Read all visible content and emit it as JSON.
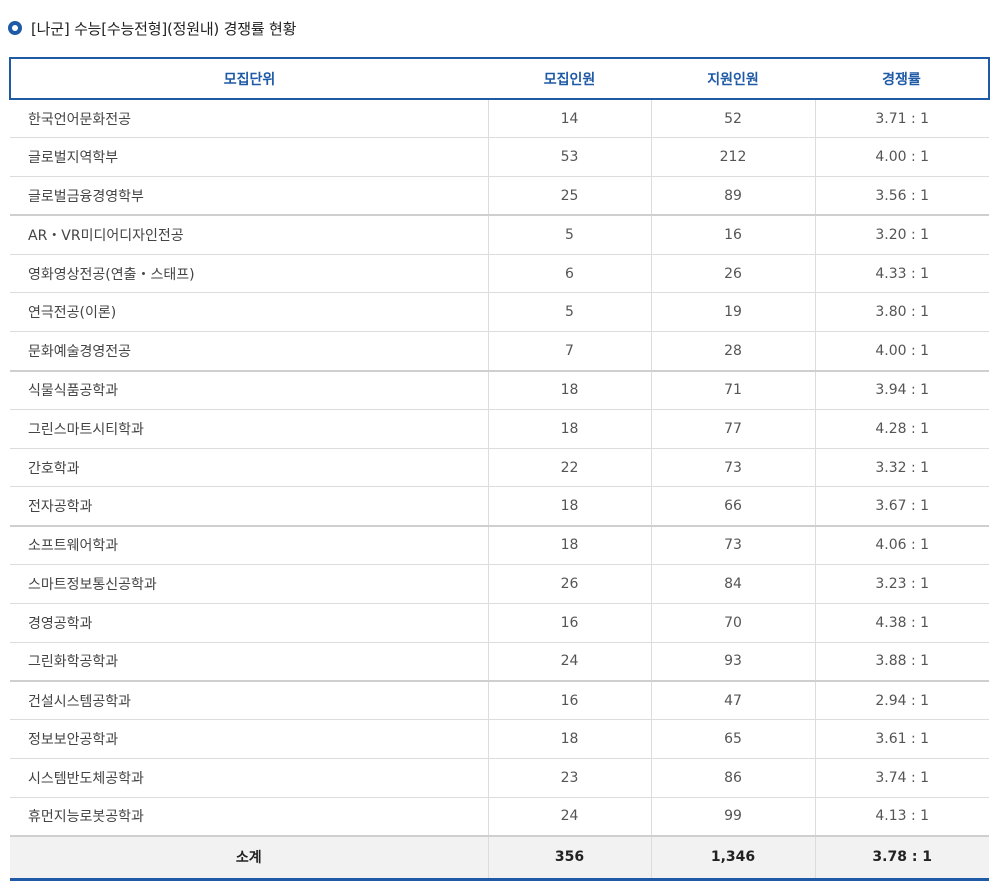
{
  "title": "[나군] 수능[수능전형](정원내) 경쟁률 현황",
  "colors": {
    "accent": "#1f5aa6",
    "footer_bg": "#f2f2f2",
    "grid_line": "#dcdcdc"
  },
  "icons": {
    "bullet": "radio-bullet-icon"
  },
  "table": {
    "headers": {
      "unit": "모집단위",
      "quota": "모집인원",
      "applicants": "지원인원",
      "ratio": "경쟁률"
    },
    "rows": [
      {
        "unit": "한국언어문화전공",
        "quota": "14",
        "applicants": "52",
        "ratio": "3.71 : 1"
      },
      {
        "unit": "글로벌지역학부",
        "quota": "53",
        "applicants": "212",
        "ratio": "4.00 : 1"
      },
      {
        "unit": "글로벌금융경영학부",
        "quota": "25",
        "applicants": "89",
        "ratio": "3.56 : 1"
      },
      {
        "unit": "AR・VR미디어디자인전공",
        "quota": "5",
        "applicants": "16",
        "ratio": "3.20 : 1"
      },
      {
        "unit": "영화영상전공(연출・스태프)",
        "quota": "6",
        "applicants": "26",
        "ratio": "4.33 : 1"
      },
      {
        "unit": "연극전공(이론)",
        "quota": "5",
        "applicants": "19",
        "ratio": "3.80 : 1"
      },
      {
        "unit": "문화예술경영전공",
        "quota": "7",
        "applicants": "28",
        "ratio": "4.00 : 1"
      },
      {
        "unit": "식물식품공학과",
        "quota": "18",
        "applicants": "71",
        "ratio": "3.94 : 1"
      },
      {
        "unit": "그린스마트시티학과",
        "quota": "18",
        "applicants": "77",
        "ratio": "4.28 : 1"
      },
      {
        "unit": "간호학과",
        "quota": "22",
        "applicants": "73",
        "ratio": "3.32 : 1"
      },
      {
        "unit": "전자공학과",
        "quota": "18",
        "applicants": "66",
        "ratio": "3.67 : 1"
      },
      {
        "unit": "소프트웨어학과",
        "quota": "18",
        "applicants": "73",
        "ratio": "4.06 : 1"
      },
      {
        "unit": "스마트정보통신공학과",
        "quota": "26",
        "applicants": "84",
        "ratio": "3.23 : 1"
      },
      {
        "unit": "경영공학과",
        "quota": "16",
        "applicants": "70",
        "ratio": "4.38 : 1"
      },
      {
        "unit": "그린화학공학과",
        "quota": "24",
        "applicants": "93",
        "ratio": "3.88 : 1"
      },
      {
        "unit": "건설시스템공학과",
        "quota": "16",
        "applicants": "47",
        "ratio": "2.94 : 1"
      },
      {
        "unit": "정보보안공학과",
        "quota": "18",
        "applicants": "65",
        "ratio": "3.61 : 1"
      },
      {
        "unit": "시스템반도체공학과",
        "quota": "23",
        "applicants": "86",
        "ratio": "3.74 : 1"
      },
      {
        "unit": "휴먼지능로봇공학과",
        "quota": "24",
        "applicants": "99",
        "ratio": "4.13 : 1"
      }
    ],
    "subtotal": {
      "label": "소계",
      "quota": "356",
      "applicants": "1,346",
      "ratio": "3.78 : 1"
    }
  }
}
